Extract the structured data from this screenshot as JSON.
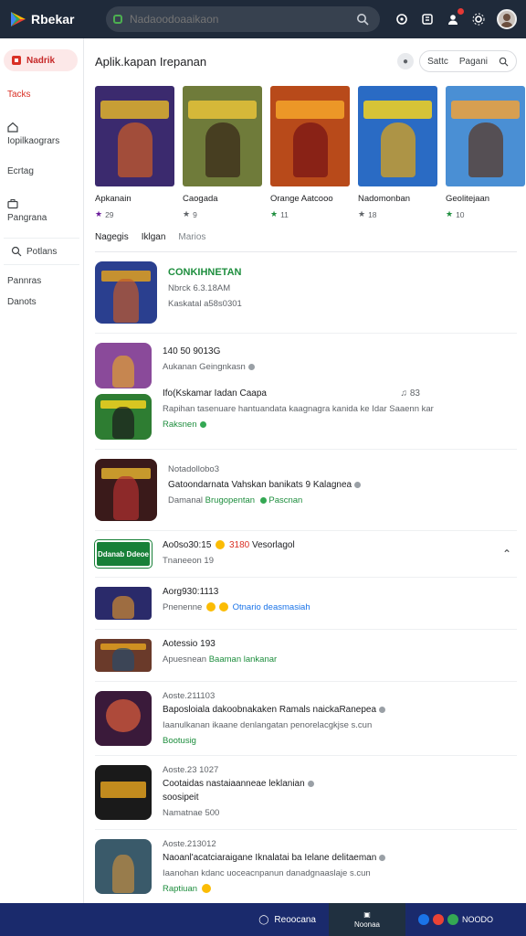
{
  "app": {
    "name": "Rbekar"
  },
  "search": {
    "placeholder": "Nadaoodoaaikaon"
  },
  "sidebar": {
    "items": [
      {
        "label": "Nadrik"
      },
      {
        "label": "Tacks"
      },
      {
        "label": "Iopilkaogrars"
      },
      {
        "label": "Ecrtag"
      },
      {
        "label": "Pangrana"
      },
      {
        "label": "Potlans"
      },
      {
        "label": "Pannras"
      },
      {
        "label": "Danots"
      }
    ]
  },
  "header": {
    "title": "Aplik.kapan Irepanan",
    "search_label": "Sattc",
    "search_value": "Pagani"
  },
  "cards": [
    {
      "name": "Apkanain",
      "rating": "29",
      "star_color": "#6a1b9a",
      "art_bg": "#3b2a6e",
      "art_fig": "#c65a2a",
      "art_ttl": "#e1b32c"
    },
    {
      "name": "Caogada",
      "rating": "9",
      "star_color": "#5f6368",
      "art_bg": "#6f7b3a",
      "art_fig": "#3a2a1a",
      "art_ttl": "#e8c33a"
    },
    {
      "name": "Orange Aatcooo",
      "rating": "11",
      "star_color": "#1e8e3e",
      "art_bg": "#b84a1a",
      "art_fig": "#7a1616",
      "art_ttl": "#f4a52a"
    },
    {
      "name": "Nadomonban",
      "rating": "18",
      "star_color": "#5f6368",
      "art_bg": "#2a6bc4",
      "art_fig": "#d9a21c",
      "art_ttl": "#f5d21e"
    },
    {
      "name": "Geolitejaan",
      "rating": "10",
      "star_color": "#1e8e3e",
      "art_bg": "#4a8fd4",
      "art_fig": "#5a3a2a",
      "art_ttl": "#f0a23a"
    }
  ],
  "tabs": [
    {
      "label": "Nagegis"
    },
    {
      "label": "Iklgan"
    },
    {
      "label": "Marios"
    }
  ],
  "list": [
    {
      "l1": "CONKIHNETAN",
      "l2": "Nbrck 6.3.18AM",
      "l3": "Kaskatal a58s0301"
    },
    {
      "l1": "140 50 9013G",
      "l2": "Aukanan Geingnkasn"
    },
    {
      "l1": "Ifo(Kskamar Iadan Caapa",
      "l2": "Rapihan tasenuare hantuandata kaagnagra kanida ke Idar Saaenn kar",
      "l3": "Raksnen",
      "corner": "83"
    },
    {
      "l1": "Notadollobo3",
      "l2": "Gatoondarnata Vahskan banikats 9 Kalagnea",
      "l3a": "Damanal",
      "l3b": "Brugopentan",
      "l3c": "Pascnan"
    },
    {
      "promo": "Ddanab Ddeoe",
      "l1": "Ao0so30:15",
      "l1b": "3180",
      "l1c": "Vesorlagol",
      "l2": "Tnaneeon 19"
    },
    {
      "l1": "Aorg930:1113",
      "l2": "Pnenenne",
      "l2b": "Otnario deasmasiah"
    },
    {
      "l1": "Aotessio 193",
      "l2": "Apuesnean",
      "l2b": "Baaman lankanar"
    },
    {
      "l1": "Aoste.211103",
      "l2": "Baposloiala dakoobnakaken Ramals naickaRanepea",
      "l3g": "Iaanulkanan ikaane denlangatan penorelacgkjse s.cun",
      "l3": "Bootusig"
    },
    {
      "l1": "Aoste.23 1027",
      "l2": "Cootaidas nastaiaanneae leklanian",
      "l3g": "soosipeit",
      "l3h": "Namatnae 500"
    },
    {
      "l1": "Aoste.213012",
      "l2": "Naoanl'acatciaraigane Iknalatai ba Ielane delitaeman",
      "l3g": "Iaanohan kdanc uoceacnpanun danadgnaaslaje s.cun",
      "l3": "Raptiuan"
    }
  ],
  "bottombar": {
    "left_label": "Reoocana",
    "mid_label": "Noonaa",
    "right_label": "NOODO"
  }
}
